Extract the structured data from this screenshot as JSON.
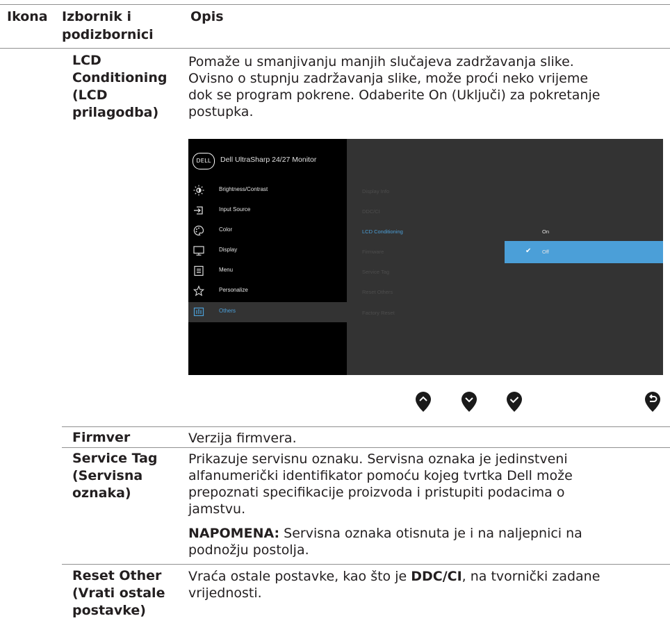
{
  "header": {
    "col1": "Ikona",
    "col2_line1": "Izbornik i",
    "col2_line2": "podizbornici",
    "col3": "Opis"
  },
  "rows": {
    "lcd": {
      "name_lines": [
        "LCD",
        "Conditioning",
        "(LCD",
        "prilagodba)"
      ],
      "desc_lines": [
        "Pomaže u smanjivanju manjih slučajeva zadržavanja slike.",
        "Ovisno o stupnju zadržavanja slike, može proći neko vrijeme",
        "dok se program pokrene. Odaberite On (Uključi) za pokretanje",
        "postupka."
      ]
    },
    "firmware": {
      "name": "Firmver",
      "desc": "Verzija firmvera."
    },
    "service_tag": {
      "name_lines": [
        "Service Tag",
        "(Servisna",
        "oznaka)"
      ],
      "desc_lines": [
        "Prikazuje servisnu oznaku. Servisna oznaka je jedinstveni",
        "alfanumerički identifikator pomoću kojeg tvrtka Dell može",
        "prepoznati specifikacije proizvoda i pristupiti podacima o",
        "jamstvu."
      ],
      "note_label": "NAPOMENA:",
      "note_line1": " Servisna oznaka otisnuta je i na naljepnici na",
      "note_line2": "podnožju postolja."
    },
    "reset_other": {
      "name_lines": [
        "Reset Other",
        "(Vrati ostale",
        "postavke)"
      ],
      "desc_pre": "Vraća ostale postavke, kao što je ",
      "desc_bold": "DDC/CI",
      "desc_post": ", na tvornički zadane",
      "desc_line2": "vrijednosti."
    }
  },
  "osd": {
    "brand": "DELL",
    "title": "Dell UltraSharp 24/27 Monitor",
    "menu": [
      {
        "label": "Brightness/Contrast",
        "icon": "brightness-icon"
      },
      {
        "label": "Input Source",
        "icon": "input-source-icon"
      },
      {
        "label": "Color",
        "icon": "color-palette-icon"
      },
      {
        "label": "Display",
        "icon": "display-monitor-icon"
      },
      {
        "label": "Menu",
        "icon": "menu-icon"
      },
      {
        "label": "Personalize",
        "icon": "star-icon"
      },
      {
        "label": "Others",
        "icon": "others-icon"
      }
    ],
    "submenu": [
      "Display Info",
      "DDC/CI",
      "LCD Conditioning",
      "Firmware",
      "Service Tag",
      "Reset Others",
      "Factory Reset"
    ],
    "options": [
      "On",
      "Off"
    ],
    "selected_option": "Off",
    "accent_color": "#4b9fd8"
  },
  "nav_buttons": [
    "up-button-icon",
    "down-button-icon",
    "confirm-button-icon",
    "back-button-icon"
  ]
}
